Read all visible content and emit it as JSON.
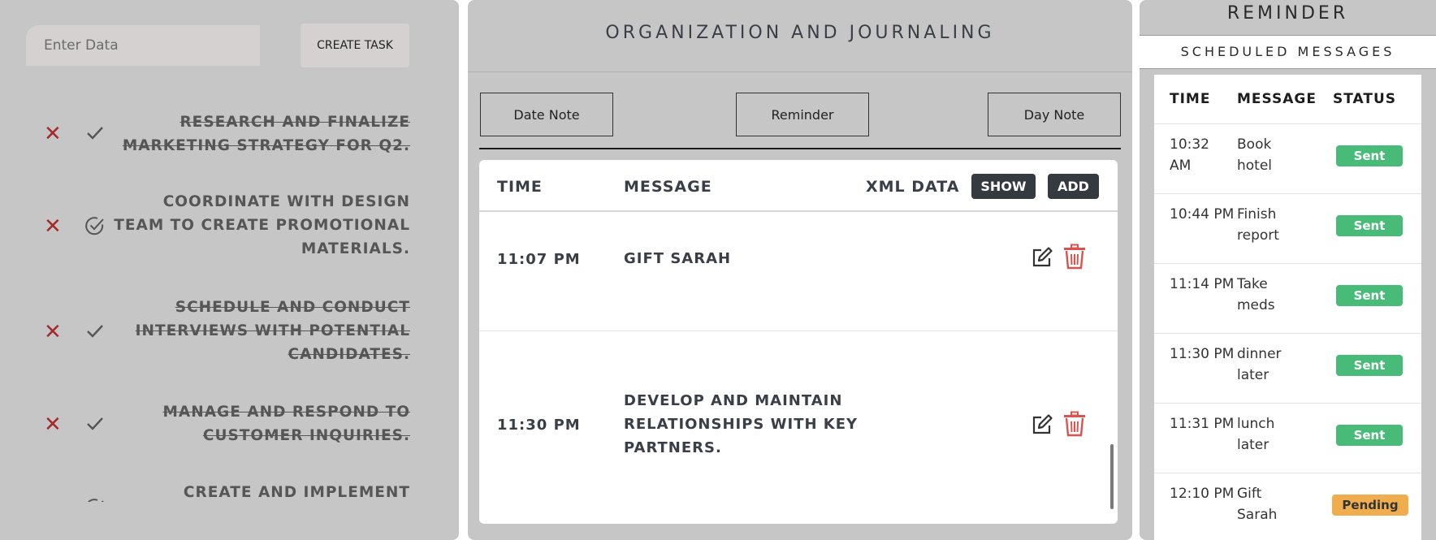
{
  "tasks": {
    "input_placeholder": "Enter Data",
    "create_label": "CREATE TASK",
    "items": [
      {
        "text": "RESEARCH AND FINALIZE MARKETING STRATEGY FOR Q2.",
        "done": true
      },
      {
        "text": "COORDINATE WITH DESIGN TEAM TO CREATE PROMOTIONAL MATERIALS.",
        "done": false
      },
      {
        "text": "SCHEDULE AND CONDUCT INTERVIEWS WITH POTENTIAL CANDIDATES.",
        "done": true
      },
      {
        "text": "MANAGE AND RESPOND TO CUSTOMER INQUIRIES.",
        "done": true
      },
      {
        "text": "CREATE AND IMPLEMENT",
        "done": false
      }
    ],
    "icons": {
      "delete": "close-icon",
      "complete": "check-icon",
      "complete_circle": "check-circle-icon"
    },
    "colors": {
      "delete": "#a52a2a"
    }
  },
  "journal": {
    "title": "ORGANIZATION AND JOURNALING",
    "modes": [
      "Date Note",
      "Reminder",
      "Day Note"
    ],
    "columns": {
      "time": "TIME",
      "message": "MESSAGE",
      "xml": "XML DATA"
    },
    "show_label": "SHOW",
    "add_label": "ADD",
    "rows": [
      {
        "time": "11:07 PM",
        "message": "GIFT SARAH"
      },
      {
        "time": "11:30 PM",
        "message": "DEVELOP AND MAINTAIN RELATIONSHIPS WITH KEY PARTNERS."
      }
    ],
    "icons": {
      "edit": "edit-icon",
      "delete": "trash-icon"
    },
    "colors": {
      "delete": "#d9534f"
    }
  },
  "reminder": {
    "title": "REMINDER",
    "subtitle": "SCHEDULED MESSAGES",
    "columns": {
      "time": "TIME",
      "message": "MESSAGE",
      "status": "STATUS"
    },
    "rows": [
      {
        "time": "10:32 AM",
        "message": "Book hotel",
        "status": "Sent"
      },
      {
        "time": "10:44 PM",
        "message": "Finish report",
        "status": "Sent"
      },
      {
        "time": "11:14 PM",
        "message": "Take meds",
        "status": "Sent"
      },
      {
        "time": "11:30 PM",
        "message": "dinner later",
        "status": "Sent"
      },
      {
        "time": "11:31 PM",
        "message": "lunch later",
        "status": "Sent"
      },
      {
        "time": "12:10 PM",
        "message": "Gift Sarah",
        "status": "Pending"
      }
    ],
    "colors": {
      "sent": "#48bb78",
      "pending": "#f0ad4e"
    }
  }
}
